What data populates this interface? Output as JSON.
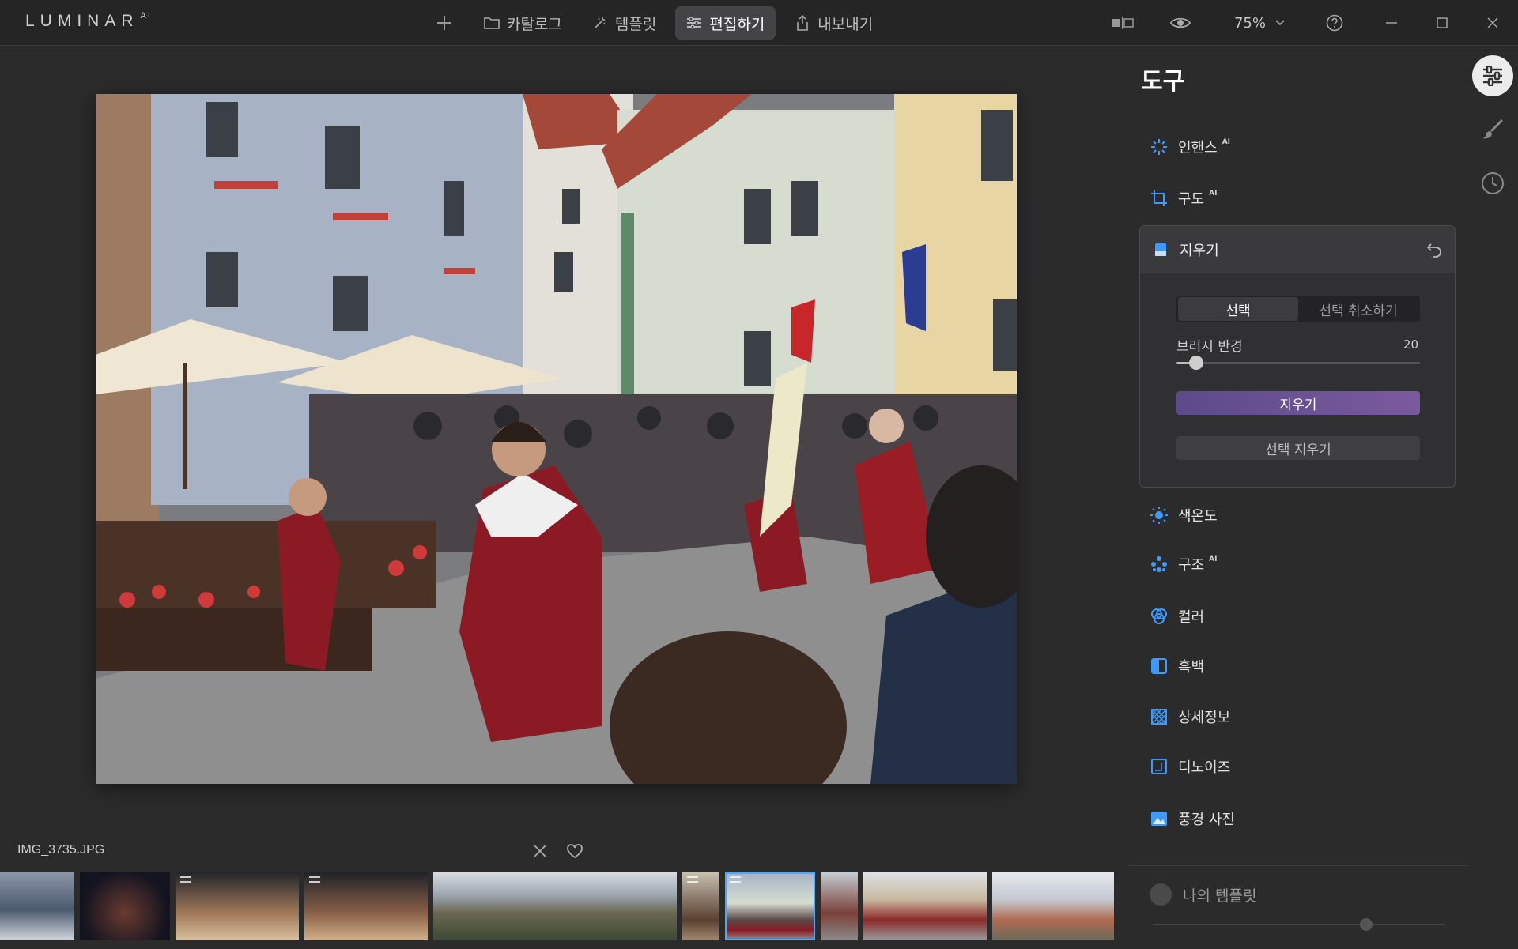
{
  "app": {
    "logo": "LUMINAR",
    "logo_sup": "AI"
  },
  "nav": {
    "catalog": "카탈로그",
    "templates": "템플릿",
    "edit": "편집하기",
    "export": "내보내기"
  },
  "top_right": {
    "zoom": "75%"
  },
  "panel": {
    "title": "도구",
    "tools_top": [
      {
        "label": "인핸스",
        "ai": "AI"
      },
      {
        "label": "구도",
        "ai": "AI"
      }
    ],
    "erase": {
      "title": "지우기",
      "seg_select": "선택",
      "seg_deselect": "선택 취소하기",
      "brush_label": "브러시 반경",
      "brush_value": "20",
      "brush_fraction": 0.08,
      "erase_button": "지우기",
      "clear_button": "선택 지우기"
    },
    "tools_bottom": [
      {
        "label": "색온도",
        "ai": ""
      },
      {
        "label": "구조",
        "ai": "AI"
      },
      {
        "label": "컬러",
        "ai": ""
      },
      {
        "label": "흑백",
        "ai": ""
      },
      {
        "label": "상세정보",
        "ai": ""
      },
      {
        "label": "디노이즈",
        "ai": ""
      },
      {
        "label": "풍경 사진",
        "ai": ""
      }
    ],
    "my_templates": "나의 템플릿"
  },
  "filmstrip": {
    "filename": "IMG_3735.JPG"
  },
  "colors": {
    "accent": "#4aa8ff",
    "erase_button": "#6b528f",
    "icon_blue": "#3d9bff"
  }
}
